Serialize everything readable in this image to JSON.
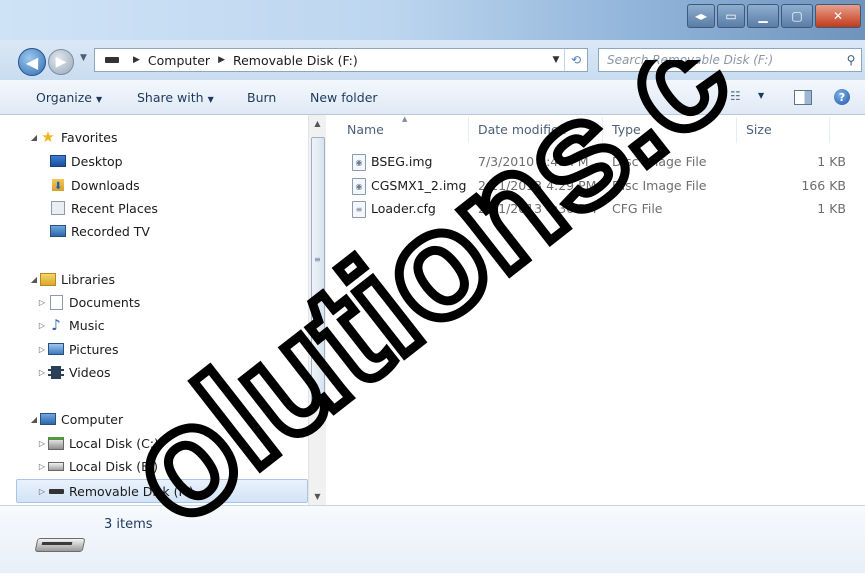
{
  "address": {
    "crumbs": [
      "Computer",
      "Removable Disk (F:)"
    ],
    "search_placeholder": "Search Removable Disk (F:)"
  },
  "toolbar": {
    "organize": "Organize",
    "share_with": "Share with",
    "burn": "Burn",
    "new_folder": "New folder"
  },
  "nav": {
    "favorites": "Favorites",
    "desktop": "Desktop",
    "downloads": "Downloads",
    "recent_places": "Recent Places",
    "recorded_tv": "Recorded TV",
    "libraries": "Libraries",
    "documents": "Documents",
    "music": "Music",
    "pictures": "Pictures",
    "videos": "Videos",
    "computer": "Computer",
    "local_c": "Local Disk (C:)",
    "local_e": "Local Disk (E:)",
    "removable_f": "Removable Disk (F:)"
  },
  "columns": {
    "name": "Name",
    "date": "Date modified",
    "type": "Type",
    "size": "Size"
  },
  "files": [
    {
      "name": "BSEG.img",
      "date": "7/3/2010 8:49 PM",
      "type": "Disc Image File",
      "size": "1 KB"
    },
    {
      "name": "CGSMX1_2.img",
      "date": "2/11/2013 4:29 PM",
      "type": "Disc Image File",
      "size": "166 KB"
    },
    {
      "name": "Loader.cfg",
      "date": "2/11/2013 4:36 PM",
      "type": "CFG File",
      "size": "1 KB"
    }
  ],
  "details": {
    "item_count": "3 items"
  },
  "watermark": {
    "text": "olutions.c"
  },
  "colors": {
    "selection": "#d2e3f6",
    "close_button": "#c13b1c",
    "text": "#1e395b"
  }
}
